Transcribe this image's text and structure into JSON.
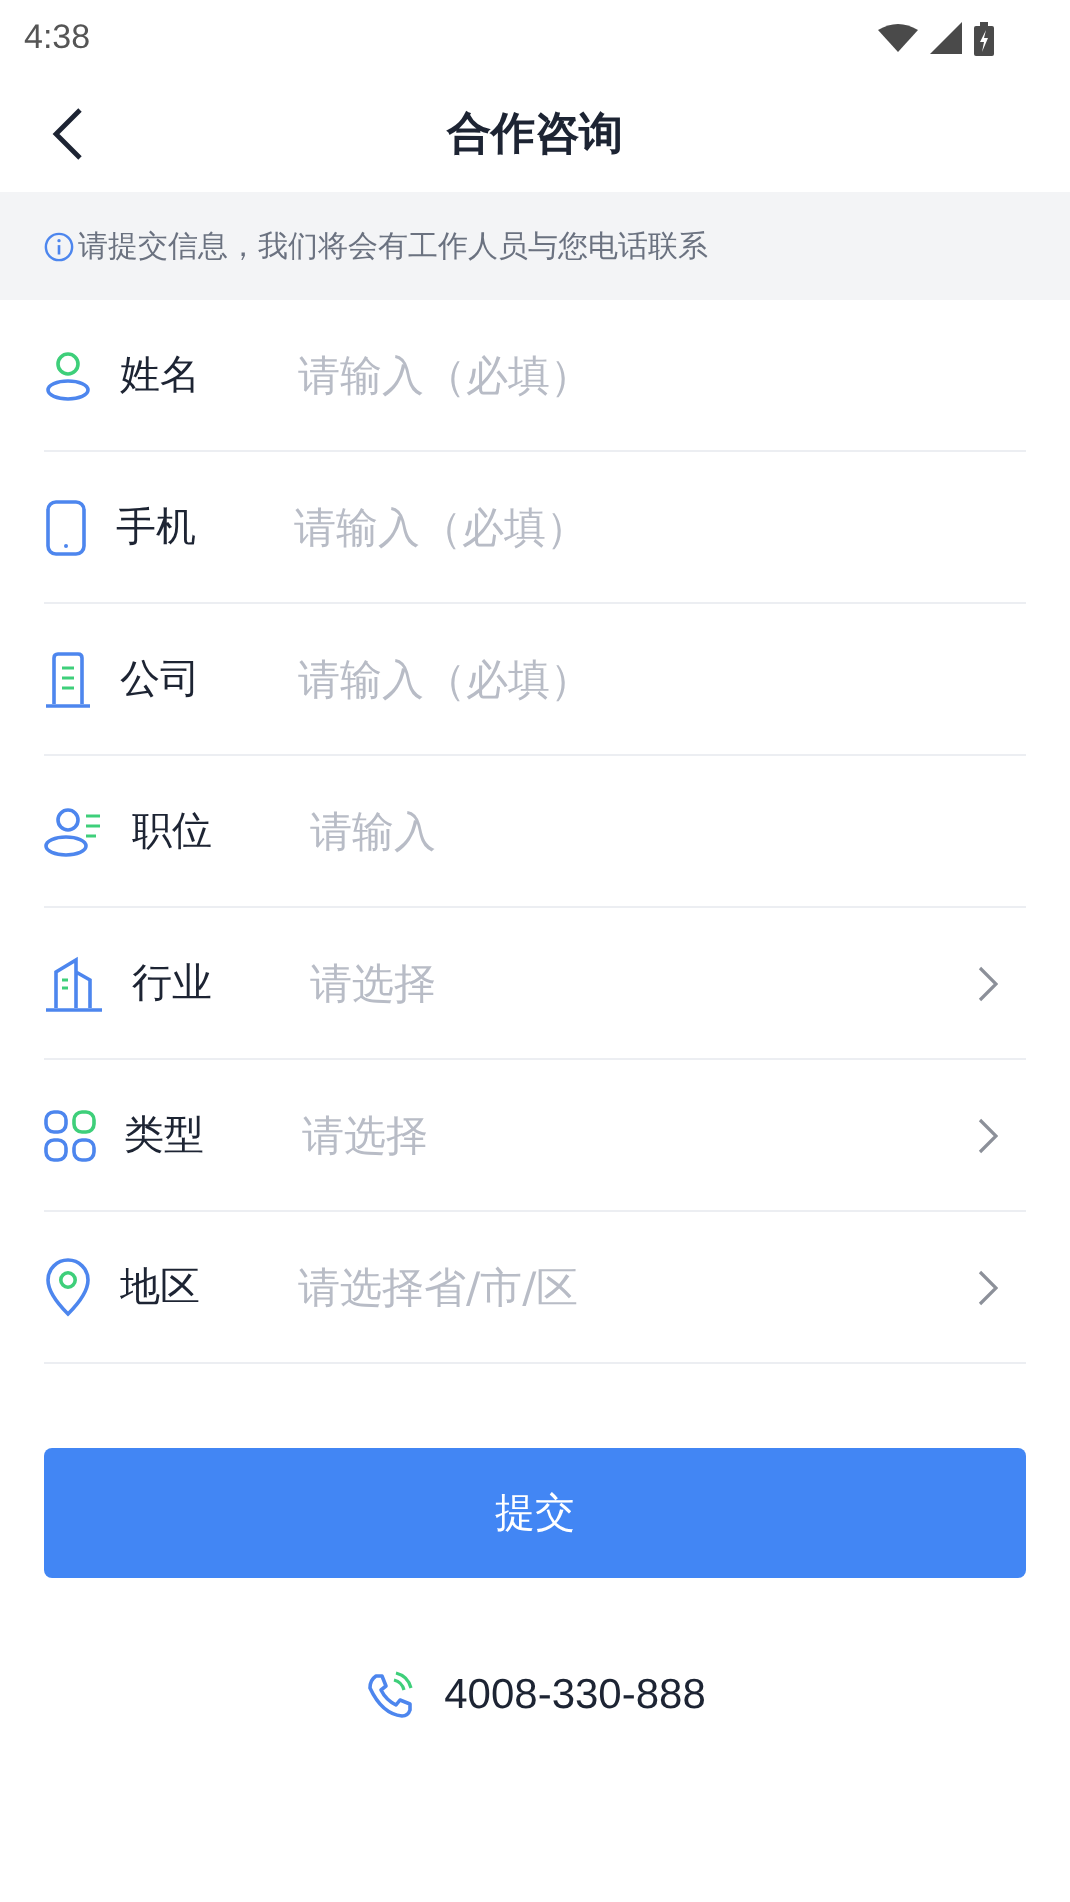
{
  "status_bar": {
    "time": "4:38"
  },
  "header": {
    "title": "合作咨询"
  },
  "notice": {
    "text": "请提交信息，我们将会有工作人员与您电话联系"
  },
  "fields": [
    {
      "kind": "input",
      "label": "姓名",
      "placeholder": "请输入（必填）"
    },
    {
      "kind": "input",
      "label": "手机",
      "placeholder": "请输入（必填）"
    },
    {
      "kind": "input",
      "label": "公司",
      "placeholder": "请输入（必填）"
    },
    {
      "kind": "input",
      "label": "职位",
      "placeholder": "请输入"
    },
    {
      "kind": "select",
      "label": "行业",
      "placeholder": "请选择"
    },
    {
      "kind": "select",
      "label": "类型",
      "placeholder": "请选择"
    },
    {
      "kind": "select",
      "label": "地区",
      "placeholder": "请选择省/市/区"
    }
  ],
  "submit": {
    "label": "提交"
  },
  "hotline": {
    "number": "4008-330-888"
  }
}
